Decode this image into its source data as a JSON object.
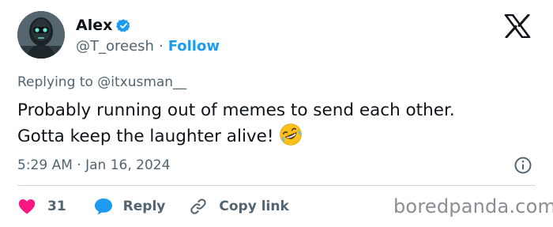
{
  "author": {
    "display_name": "Alex",
    "handle": "@T_oreesh",
    "separator": "·",
    "follow_label": "Follow",
    "verified": true
  },
  "reply": {
    "prefix": "Replying to",
    "mention": "@itxusman__"
  },
  "tweet": {
    "text": "Probably running out of memes to send each other. Gotta keep the laughter alive!",
    "emoji": "rolling-on-floor-laughing-emoji"
  },
  "meta": {
    "time": "5:29 AM",
    "separator": "·",
    "date": "Jan 16, 2024"
  },
  "actions": {
    "likes_count": "31",
    "reply_label": "Reply",
    "copy_link_label": "Copy link"
  },
  "watermark": "boredpanda.com",
  "colors": {
    "accent": "#1d9bf0",
    "heart": "#f91880",
    "muted_text": "#536471",
    "primary_text": "#0f1419"
  }
}
